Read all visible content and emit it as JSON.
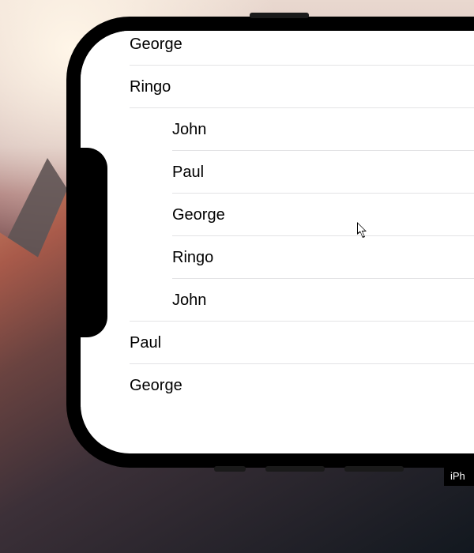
{
  "list": {
    "rows": [
      {
        "label": "George",
        "indent": "outer"
      },
      {
        "label": "Ringo",
        "indent": "outer"
      },
      {
        "label": "John",
        "indent": "inner"
      },
      {
        "label": "Paul",
        "indent": "inner"
      },
      {
        "label": "George",
        "indent": "inner"
      },
      {
        "label": "Ringo",
        "indent": "inner"
      },
      {
        "label": "John",
        "indent": "inner",
        "last_inner": true
      },
      {
        "label": "Paul",
        "indent": "outer"
      },
      {
        "label": "George",
        "indent": "outer"
      }
    ]
  },
  "corner_label": "iPh"
}
